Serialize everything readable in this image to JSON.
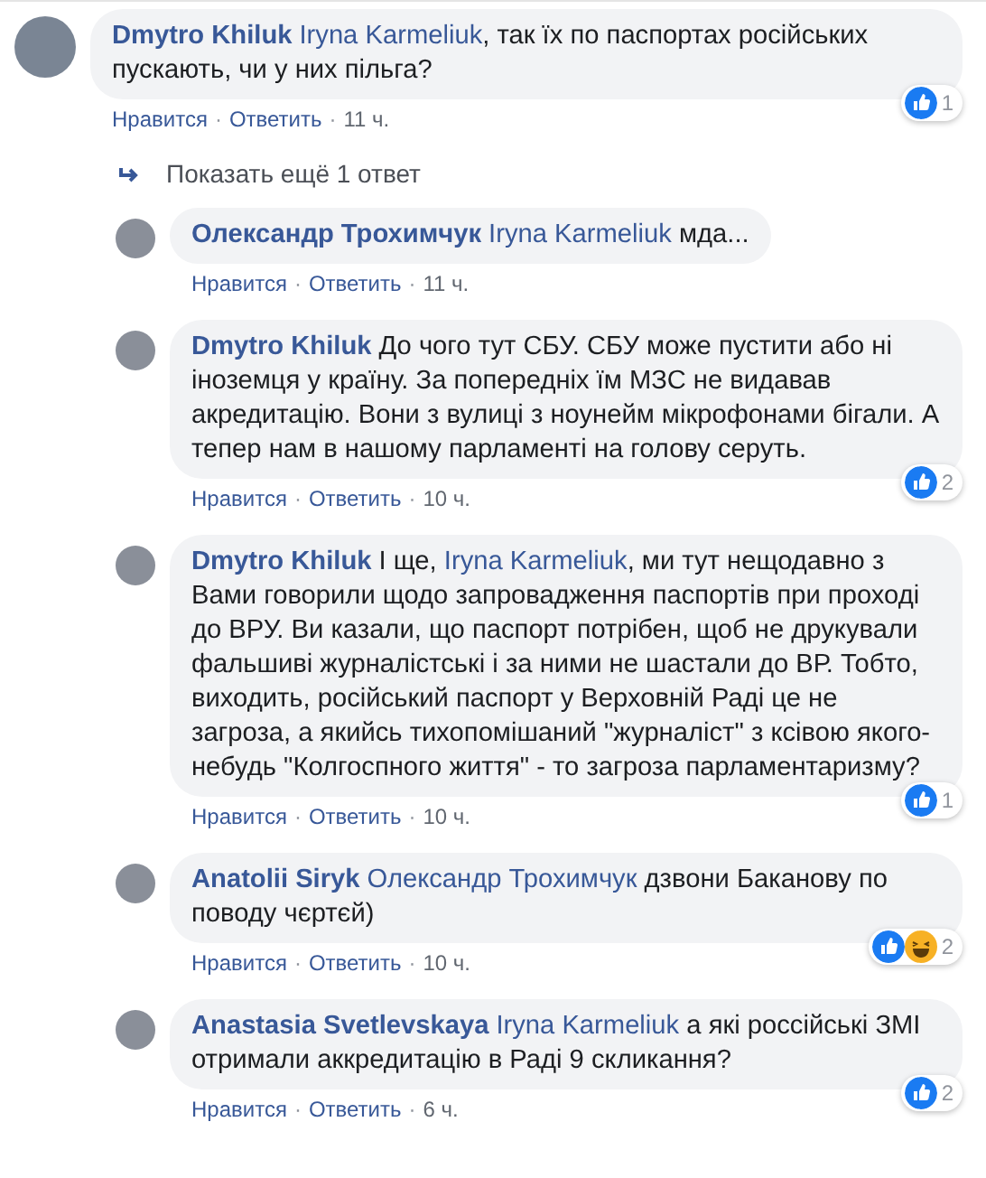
{
  "thread": {
    "comment": {
      "author": "Dmytro Khiluk",
      "body": [
        {
          "kind": "mention",
          "text": "Iryna Karmeliuk"
        },
        {
          "kind": "text",
          "text": ", так їх по паспортах російських пускають, чи у них пільга?"
        }
      ],
      "reactions": {
        "icons": [
          {
            "kind": "like"
          }
        ],
        "count": "1"
      },
      "actions": [
        {
          "kind": "like",
          "text": "Нравится"
        },
        {
          "kind": "separator",
          "text": "·"
        },
        {
          "kind": "reply",
          "text": "Ответить"
        },
        {
          "kind": "separator",
          "text": "·"
        },
        {
          "kind": "time",
          "text": "11 ч."
        }
      ]
    },
    "show_more_replies": {
      "label": "Показать ещё 1 ответ"
    },
    "replies": [
      {
        "author": "Олександр Трохимчук",
        "body": [
          {
            "kind": "mention",
            "text": "Iryna Karmeliuk"
          },
          {
            "kind": "text",
            "text": " мда..."
          }
        ],
        "actions": [
          {
            "kind": "like",
            "text": "Нравится"
          },
          {
            "kind": "separator",
            "text": "·"
          },
          {
            "kind": "reply",
            "text": "Ответить"
          },
          {
            "kind": "separator",
            "text": "·"
          },
          {
            "kind": "time",
            "text": "11 ч."
          }
        ]
      },
      {
        "author": "Dmytro Khiluk",
        "body": [
          {
            "kind": "text",
            "text": "До чого тут СБУ. СБУ може пустити або ні іноземця у країну. За попередніх їм МЗС не видавав акредитацію. Вони з вулиці з ноунейм мікрофонами бігали. А тепер нам в нашому парламенті на голову серуть."
          }
        ],
        "reactions": {
          "icons": [
            {
              "kind": "like"
            }
          ],
          "count": "2"
        },
        "actions": [
          {
            "kind": "like",
            "text": "Нравится"
          },
          {
            "kind": "separator",
            "text": "·"
          },
          {
            "kind": "reply",
            "text": "Ответить"
          },
          {
            "kind": "separator",
            "text": "·"
          },
          {
            "kind": "time",
            "text": "10 ч."
          }
        ]
      },
      {
        "author": "Dmytro Khiluk",
        "body": [
          {
            "kind": "text",
            "text": "І ще, "
          },
          {
            "kind": "mention",
            "text": "Iryna Karmeliuk"
          },
          {
            "kind": "text",
            "text": ", ми тут нещодавно з Вами говорили щодо запровадження паспортів при проході до ВРУ. Ви казали, що паспорт потрібен, щоб не друкували фальшиві журналістські і за ними не шастали до ВР. Тобто, виходить, російський паспорт у Верховній Раді це не загроза, а якийсь тихопомішаний \"журналіст\" з ксівою якого-небудь \"Колгоспного життя\" - то загроза парламентаризму?"
          }
        ],
        "reactions": {
          "icons": [
            {
              "kind": "like"
            }
          ],
          "count": "1"
        },
        "actions": [
          {
            "kind": "like",
            "text": "Нравится"
          },
          {
            "kind": "separator",
            "text": "·"
          },
          {
            "kind": "reply",
            "text": "Ответить"
          },
          {
            "kind": "separator",
            "text": "·"
          },
          {
            "kind": "time",
            "text": "10 ч."
          }
        ]
      },
      {
        "author": "Anatolii Siryk",
        "body": [
          {
            "kind": "mention",
            "text": "Олександр Трохимчук"
          },
          {
            "kind": "text",
            "text": " дзвони Баканову по поводу чєртєй)"
          }
        ],
        "reactions": {
          "icons": [
            {
              "kind": "like"
            },
            {
              "kind": "haha"
            }
          ],
          "count": "2"
        },
        "actions": [
          {
            "kind": "like",
            "text": "Нравится"
          },
          {
            "kind": "separator",
            "text": "·"
          },
          {
            "kind": "reply",
            "text": "Ответить"
          },
          {
            "kind": "separator",
            "text": "·"
          },
          {
            "kind": "time",
            "text": "10 ч."
          }
        ]
      },
      {
        "author": "Anastasia Svetlevskaya",
        "body": [
          {
            "kind": "mention",
            "text": "Iryna Karmeliuk"
          },
          {
            "kind": "text",
            "text": " а які россійські ЗМІ отримали аккредитацію в Раді 9 скликання?"
          }
        ],
        "reactions": {
          "icons": [
            {
              "kind": "like"
            }
          ],
          "count": "2"
        },
        "actions": [
          {
            "kind": "like",
            "text": "Нравится"
          },
          {
            "kind": "separator",
            "text": "·"
          },
          {
            "kind": "reply",
            "text": "Ответить"
          },
          {
            "kind": "separator",
            "text": "·"
          },
          {
            "kind": "time",
            "text": "6 ч."
          }
        ]
      }
    ]
  }
}
